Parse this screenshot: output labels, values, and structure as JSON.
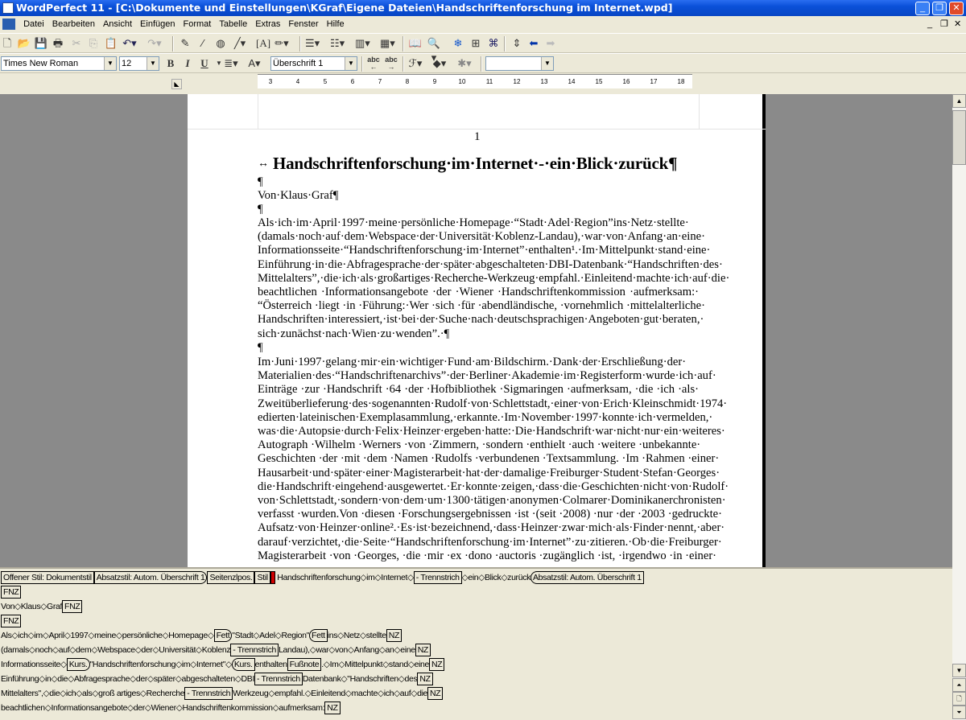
{
  "window": {
    "title": "WordPerfect 11 - [C:\\Dokumente und Einstellungen\\KGraf\\Eigene Dateien\\Handschriftenforschung im Internet.wpd]"
  },
  "menu": [
    "Datei",
    "Bearbeiten",
    "Ansicht",
    "Einfügen",
    "Format",
    "Tabelle",
    "Extras",
    "Fenster",
    "Hilfe"
  ],
  "propertybar": {
    "font": "Times New Roman",
    "size": "12",
    "style": "Überschrift 1",
    "bold": "B",
    "italic": "I",
    "underline": "U",
    "extra": ""
  },
  "ruler": {
    "ticks": [
      "3",
      "4",
      "5",
      "6",
      "7",
      "8",
      "9",
      "10",
      "11",
      "12",
      "13",
      "14",
      "15",
      "16",
      "17",
      "18"
    ]
  },
  "document": {
    "page_number": "1",
    "title": "Handschriftenforschung·im·Internet·-·ein·Blick·zurück",
    "pilcrow": "¶",
    "author": "Von·Klaus·Graf¶",
    "para1": [
      "Als·ich·im·April·1997·meine·persönliche·Homepage·“Stadt·Adel·Region”ins·Netz·stellte·",
      "(damals·noch·auf·dem·Webspace·der·Universität·Koblenz-Landau),·war·von·Anfang·an·eine·",
      "Informationsseite·“Handschriftenforschung·im·Internet”·enthalten¹.·Im·Mittelpunkt·stand·eine·",
      "Einführung·in·die·Abfragesprache·der·später·abgeschalteten·DBI-Datenbank·“Handschriften·des·",
      "Mittelalters”,·die·ich·als·großartiges·Recherche-Werkzeug·empfahl.·Einleitend·machte·ich·auf·die·",
      "beachtlichen ·Informationsangebote ·der ·Wiener ·Handschriftenkommission ·aufmerksam:·",
      "“Österreich ·liegt ·in ·Führung:·Wer ·sich ·für ·abendländische, ·vornehmlich ·mittelalterliche·",
      "Handschriften·interessiert,·ist·bei·der·Suche·nach·deutschsprachigen·Angeboten·gut·beraten,·",
      "sich·zunächst·nach·Wien·zu·wenden”.·¶"
    ],
    "para2": [
      "Im·Juni·1997·gelang·mir·ein·wichtiger·Fund·am·Bildschirm.·Dank·der·Erschließung·der·",
      "Materialien·des·“Handschriftenarchivs”·der·Berliner·Akademie·im·Registerform·wurde·ich·auf·",
      "Einträge ·zur ·Handschrift ·64 ·der ·Hofbibliothek ·Sigmaringen ·aufmerksam, ·die ·ich ·als·",
      "Zweitüberlieferung·des·sogenannten·Rudolf·von·Schlettstadt,·einer·von·Erich·Kleinschmidt·1974·",
      "edierten·lateinischen·Exemplasammlung,·erkannte.·Im·November·1997·konnte·ich·vermelden,·",
      "was·die·Autopsie·durch·Felix·Heinzer·ergeben·hatte:·Die·Handschrift·war·nicht·nur·ein·weiteres·",
      "Autograph ·Wilhelm ·Werners ·von ·Zimmern, ·sondern ·enthielt ·auch ·weitere ·unbekannte·",
      "Geschichten ·der ·mit ·dem ·Namen ·Rudolfs ·verbundenen ·Textsammlung. ·Im ·Rahmen ·einer·",
      "Hausarbeit·und·später·einer·Magisterarbeit·hat·der·damalige·Freiburger·Student·Stefan·Georges·",
      "die·Handschrift·eingehend·ausgewertet.·Er·konnte·zeigen,·dass·die·Geschichten·nicht·von·Rudolf·",
      "von·Schlettstadt,·sondern·von·dem·um·1300·tätigen·anonymen·Colmarer·Dominikanerchronisten·",
      "verfasst ·wurden.Von ·diesen ·Forschungsergebnissen ·ist ·(seit ·2008) ·nur ·der ·2003 ·gedruckte·",
      "Aufsatz·von·Heinzer·online².·Es·ist·bezeichnend,·dass·Heinzer·zwar·mich·als·Finder·nennt,·aber·",
      "darauf·verzichtet,·die·Seite·“Handschriftenforschung·im·Internet”·zu·zitieren.·Ob·die·Freiburger·",
      "Magisterarbeit ·von ·Georges, ·die ·mir ·ex ·dono ·auctoris ·zugänglich ·ist, ·irgendwo ·in ·einer·"
    ]
  },
  "reveal_codes": [
    [
      {
        "c": "Offener Stil: Dokumentstil"
      },
      {
        "c": "Absatzstil: Autom. Überschrift 1",
        "s": "right"
      },
      {
        "c": "Seitenzlpos."
      },
      {
        "c": "Stil"
      },
      {
        "c": "",
        "s": "red"
      },
      {
        "t": " Handschriftenforschung◇im◇Internet◇"
      },
      {
        "c": "- Trennstrich"
      },
      {
        "t": "◇ein◇Blick◇zurück"
      },
      {
        "c": "Absatzstil: Autom. Überschrift 1",
        "s": "left"
      }
    ],
    [
      {
        "c": "FNZ"
      }
    ],
    [
      {
        "t": "Von◇Klaus◇Graf"
      },
      {
        "c": "FNZ"
      }
    ],
    [
      {
        "c": "FNZ"
      }
    ],
    [
      {
        "t": "Als◇ich◇im◇April◇1997◇meine◇persönliche◇Homepage◇"
      },
      {
        "c": "Fett",
        "s": "right"
      },
      {
        "t": "\"Stadt◇Adel◇Region\""
      },
      {
        "c": "Fett",
        "s": "left"
      },
      {
        "t": "ins◇Netz◇stellte"
      },
      {
        "c": "NZ"
      }
    ],
    [
      {
        "t": "(damals◇noch◇auf◇dem◇Webspace◇der◇Universität◇Koblenz"
      },
      {
        "c": "- Trennstrich"
      },
      {
        "t": "Landau),◇war◇von◇Anfang◇an◇eine"
      },
      {
        "c": "NZ"
      }
    ],
    [
      {
        "t": "Informationsseite◇"
      },
      {
        "c": "Kurs.",
        "s": "right"
      },
      {
        "t": "\"Handschriftenforschung◇im◇Internet\"◇"
      },
      {
        "c": "Kurs.",
        "s": "left"
      },
      {
        "t": "enthalten"
      },
      {
        "c": "Fußnote"
      },
      {
        "t": ".◇Im◇Mittelpunkt◇stand◇eine"
      },
      {
        "c": "NZ"
      }
    ],
    [
      {
        "t": "Einführung◇in◇die◇Abfragesprache◇der◇später◇abgeschalteten◇DBI"
      },
      {
        "c": "- Trennstrich"
      },
      {
        "t": "Datenbank◇\"Handschriften◇des"
      },
      {
        "c": "NZ"
      }
    ],
    [
      {
        "t": "Mittelalters\",◇die◇ich◇als◇groß artiges◇Recherche"
      },
      {
        "c": "- Trennstrich"
      },
      {
        "t": "Werkzeug◇empfahl.◇Einleitend◇machte◇ich◇auf◇die"
      },
      {
        "c": "NZ"
      }
    ],
    [
      {
        "t": "beachtlichen◇Informationsangebote◇der◇Wiener◇Handschriftenkommission◇aufmerksam:"
      },
      {
        "c": "NZ"
      }
    ]
  ]
}
